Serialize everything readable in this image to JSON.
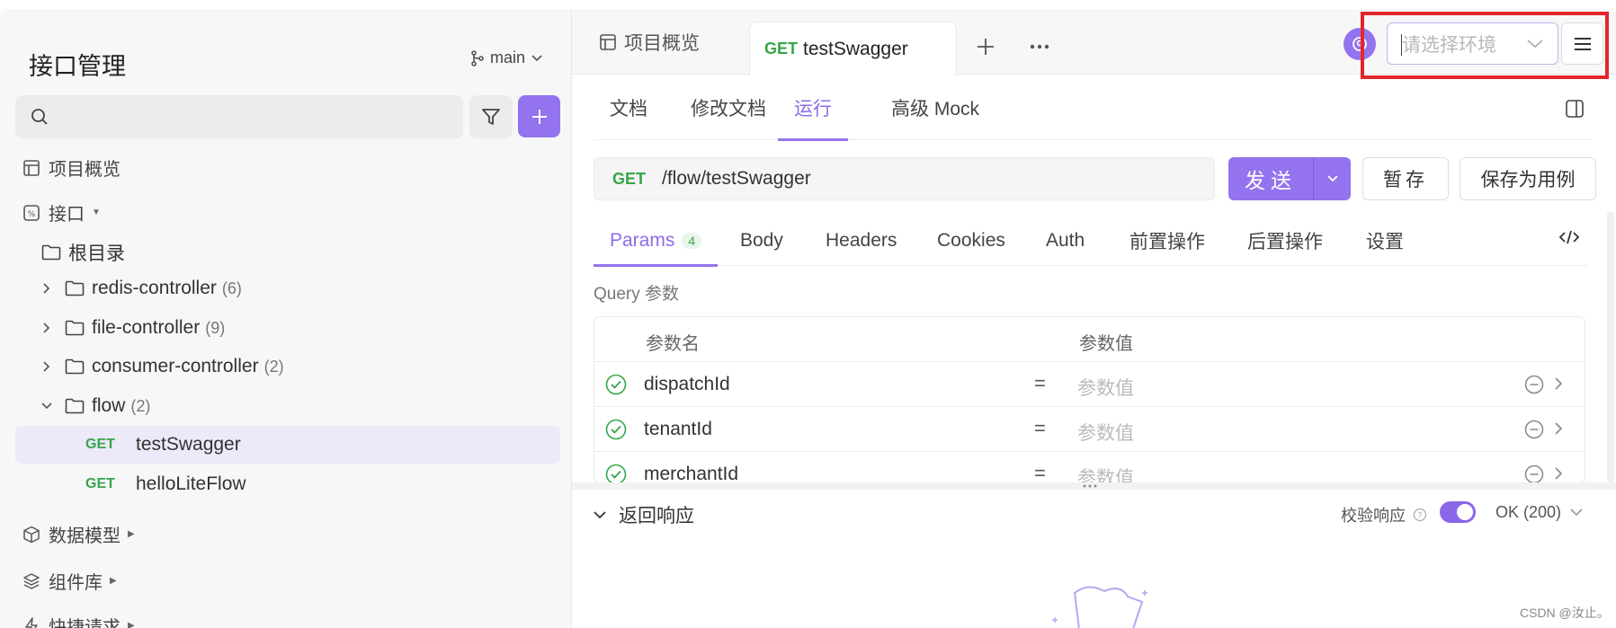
{
  "sidebar": {
    "title": "接口管理",
    "branch": "main",
    "search_placeholder": "",
    "nav": {
      "overview": "项目概览",
      "interfaces": "接口",
      "data_models": "数据模型",
      "components": "组件库",
      "quick_requests": "快捷请求"
    },
    "root": "根目录",
    "folders": [
      {
        "name": "redis-controller",
        "count": "(6)"
      },
      {
        "name": "file-controller",
        "count": "(9)"
      },
      {
        "name": "consumer-controller",
        "count": "(2)"
      },
      {
        "name": "flow",
        "count": "(2)"
      }
    ],
    "apis": [
      {
        "method": "GET",
        "name": "testSwagger"
      },
      {
        "method": "GET",
        "name": "helloLiteFlow"
      }
    ]
  },
  "topbar": {
    "overview_tab": "项目概览",
    "active_tab": {
      "method": "GET",
      "name": "testSwagger"
    },
    "env_placeholder": "请选择环境"
  },
  "subtabs": [
    "文档",
    "修改文档",
    "运行",
    "高级 Mock"
  ],
  "request": {
    "method": "GET",
    "path": "/flow/testSwagger",
    "send": "发送",
    "save_temp": "暂存",
    "save_case": "保存为用例"
  },
  "param_tabs": {
    "params": "Params",
    "params_count": "4",
    "body": "Body",
    "headers": "Headers",
    "cookies": "Cookies",
    "auth": "Auth",
    "pre": "前置操作",
    "post": "后置操作",
    "settings": "设置"
  },
  "query": {
    "label": "Query 参数",
    "col_name": "参数名",
    "col_value": "参数值",
    "rows": [
      {
        "name": "dispatchId",
        "eq": "=",
        "value_placeholder": "参数值"
      },
      {
        "name": "tenantId",
        "eq": "=",
        "value_placeholder": "参数值"
      },
      {
        "name": "merchantId",
        "eq": "=",
        "value_placeholder": "参数值"
      }
    ]
  },
  "response": {
    "title": "返回响应",
    "verify": "校验响应",
    "status": "OK (200)"
  },
  "watermark": "CSDN @汝止。",
  "colors": {
    "accent": "#9373ee",
    "get": "#35a64a",
    "highlight_box": "#e4262a"
  }
}
